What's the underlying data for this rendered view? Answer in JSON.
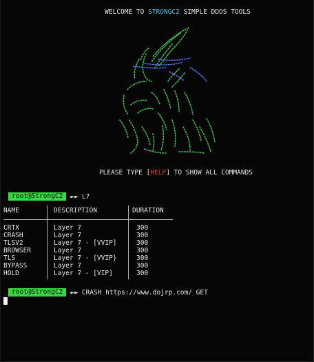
{
  "banner": {
    "prefix": "WELCOME TO ",
    "brand": "STRONGC2",
    "suffix": " SIMPLE DDOS TOOLS"
  },
  "help": {
    "prefix": "PLEASE TYPE [",
    "keyword": "HELP",
    "suffix": "] TO SHOW ALL COMMANDS"
  },
  "prompt": {
    "badge": "root@StrongC2",
    "separator": "►►"
  },
  "command1": "L7",
  "table": {
    "headers": [
      "NAME",
      "DESCRIPTION",
      "DURATION"
    ],
    "rows": [
      {
        "name": "CRTX",
        "description": "Layer 7",
        "duration": "300"
      },
      {
        "name": "CRASH",
        "description": "Layer 7",
        "duration": "300"
      },
      {
        "name": "TLSV2",
        "description": "Layer 7 - [VVIP]",
        "duration": "300"
      },
      {
        "name": "BROWSER",
        "description": "Layer 7",
        "duration": "300"
      },
      {
        "name": "TLS",
        "description": "Layer 7 - [VVIP}",
        "duration": "300"
      },
      {
        "name": "BYPASS",
        "description": "Layer 7",
        "duration": "300"
      },
      {
        "name": "HOLD",
        "description": "Layer 7 - [VIP]",
        "duration": "300"
      }
    ]
  },
  "command2": "CRASH https://www.dojrp.com/ GET",
  "colors": {
    "background": "#050505",
    "text": "#e8e8e8",
    "brand": "#55c1e3",
    "help": "#e03a3a",
    "prompt_badge": "#35d83e",
    "art_green": "#3fbf4a",
    "art_blue": "#4f6fe0"
  },
  "icons": {
    "art": "dragon-ascii-art-icon",
    "cursor": "block-cursor"
  }
}
